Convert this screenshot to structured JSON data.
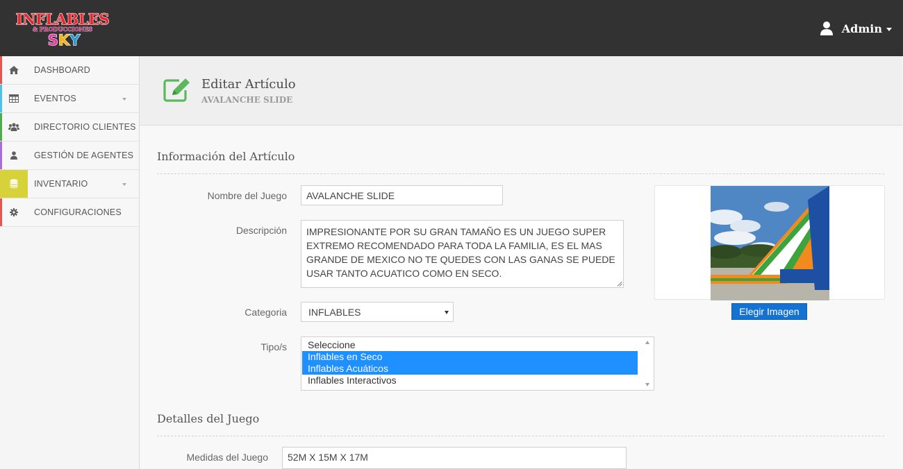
{
  "brand": {
    "logo_line1": "INFLABLES",
    "logo_line2": "& PRODUCCIONES",
    "logo_line3": "SKY"
  },
  "user": {
    "name": "Admin",
    "icon": "user-icon"
  },
  "sidebar": {
    "items": [
      {
        "label": "DASHBOARD",
        "icon": "home-icon",
        "color": "#e8544e",
        "has_submenu": false
      },
      {
        "label": "EVENTOS",
        "icon": "table-icon",
        "color": "#4fc1e9",
        "has_submenu": true
      },
      {
        "label": "DIRECTORIO CLIENTES",
        "icon": "users-icon",
        "color": "#4cae4c",
        "has_submenu": false
      },
      {
        "label": "GESTIÓN DE AGENTES",
        "icon": "user-icon",
        "color": "#ac6bd6",
        "has_submenu": false
      },
      {
        "label": "INVENTARIO",
        "icon": "database-icon",
        "color": "#d7d23a",
        "has_submenu": true,
        "active": true
      },
      {
        "label": "CONFIGURACIONES",
        "icon": "gear-icon",
        "color": "#e8544e",
        "has_submenu": false
      }
    ]
  },
  "header": {
    "title": "Editar Artículo",
    "subtitle": "AVALANCHE SLIDE",
    "icon": "edit-icon",
    "icon_color": "#5cb85c"
  },
  "section1": {
    "title": "Información del Artículo",
    "name_label": "Nombre del Juego",
    "name_value": "AVALANCHE SLIDE",
    "desc_label": "Descripción",
    "desc_value": "IMPRESIONANTE POR SU GRAN TAMAÑO ES UN JUEGO SUPER EXTREMO RECOMENDADO PARA TODA LA FAMILIA, ES EL MAS GRANDE DE MEXICO NO TE QUEDES CON LAS GANAS SE PUEDE USAR TANTO ACUATICO COMO EN SECO.",
    "category_label": "Categoria",
    "category_value": "INFLABLES",
    "types_label": "Tipo/s",
    "types_options": [
      {
        "label": "Seleccione",
        "selected": false
      },
      {
        "label": "Inflables en Seco",
        "selected": true
      },
      {
        "label": "Inflables Acuáticos",
        "selected": true
      },
      {
        "label": "Inflables Interactivos",
        "selected": false
      }
    ],
    "choose_image_label": "Elegir Imagen"
  },
  "section2": {
    "title": "Detalles del Juego",
    "size_label": "Medidas del Juego",
    "size_value": "52M X 15M X 17M"
  },
  "colors": {
    "topbar": "#323232",
    "accent_blue": "#1372d2",
    "selection_blue": "#1e90ff"
  }
}
